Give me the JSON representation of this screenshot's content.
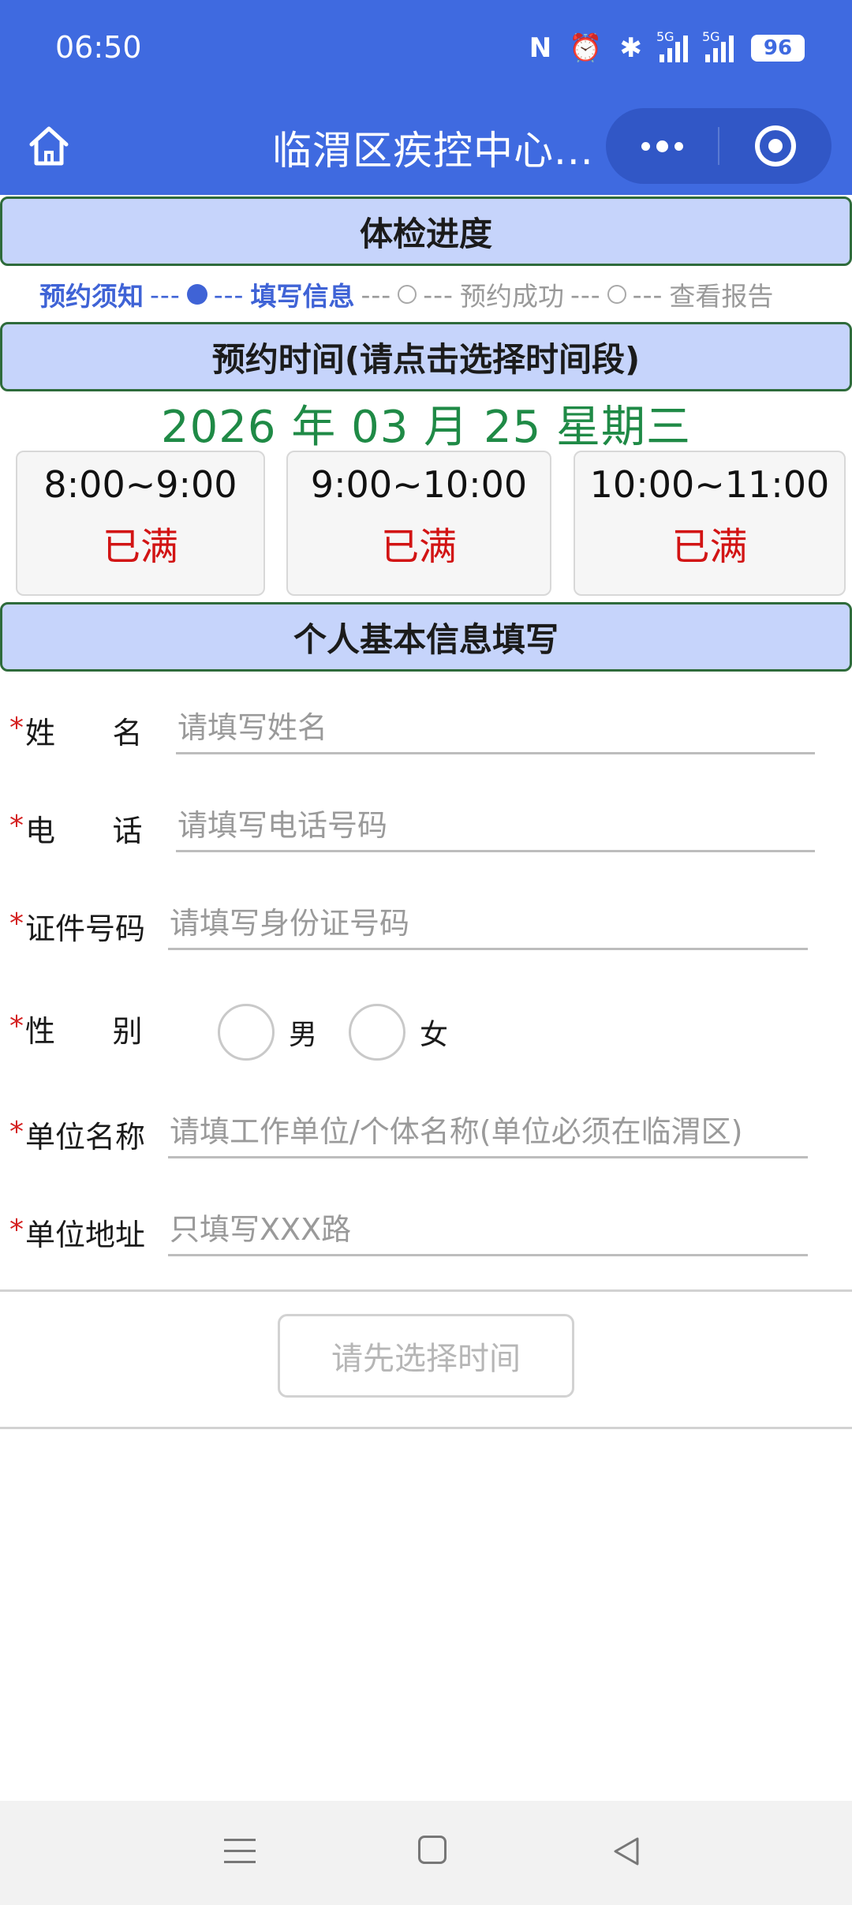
{
  "status_bar": {
    "time": "06:50",
    "nfc_icon": "N",
    "alarm_icon": "⏰",
    "bluetooth_icon": "✱",
    "network1": "5G",
    "network2": "5G",
    "battery": "96"
  },
  "nav": {
    "title": "临渭区疾控中心..."
  },
  "progress_section": {
    "header": "体检进度",
    "steps": [
      {
        "label": "预约须知",
        "state": "active"
      },
      {
        "label": "填写信息",
        "state": "active"
      },
      {
        "label": "预约成功",
        "state": "inactive"
      },
      {
        "label": "查看报告",
        "state": "inactive"
      }
    ],
    "dash": "---"
  },
  "time_section": {
    "header": "预约时间(请点击选择时间段)",
    "date": "2026 年 03 月 25 星期三",
    "slots": [
      {
        "range": "8:00~9:00",
        "state": "已满"
      },
      {
        "range": "9:00~10:00",
        "state": "已满"
      },
      {
        "range": "10:00~11:00",
        "state": "已满"
      }
    ]
  },
  "info_section": {
    "header": "个人基本信息填写",
    "required_mark": "*",
    "fields": {
      "name": {
        "label": "姓      名",
        "placeholder": "请填写姓名"
      },
      "phone": {
        "label": "电      话",
        "placeholder": "请填写电话号码"
      },
      "id": {
        "label": "证件号码",
        "placeholder": "请填写身份证号码"
      },
      "gender": {
        "label": "性      别",
        "options": [
          "男",
          "女"
        ]
      },
      "company": {
        "label": "单位名称",
        "placeholder": "请填工作单位/个体名称(单位必须在临渭区)"
      },
      "address": {
        "label": "单位地址",
        "placeholder": "只填写XXX路"
      }
    }
  },
  "submit": {
    "label": "请先选择时间"
  },
  "colors": {
    "primary": "#3f6ae0",
    "section_bg": "#c6d4fb",
    "date_green": "#1f8a46",
    "full_red": "#d21414"
  }
}
